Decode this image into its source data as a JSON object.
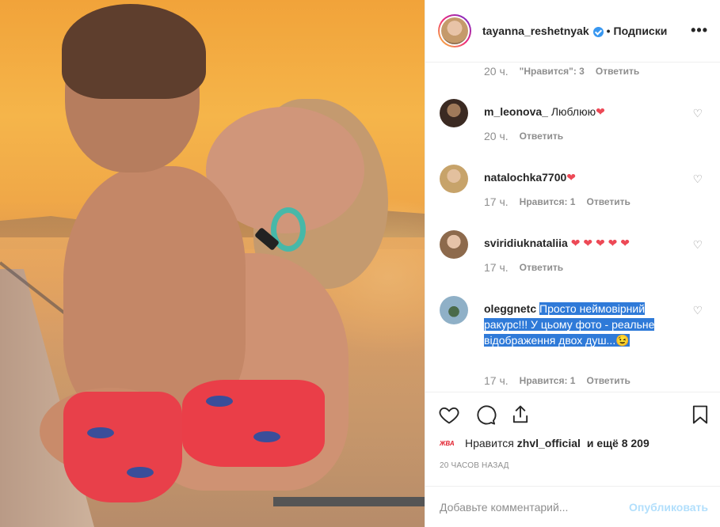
{
  "post": {
    "username": "tayanna_reshetnyak",
    "separator": "•",
    "follow_label": "Подписки",
    "more_icon": "more-icon"
  },
  "comments": {
    "top_meta": {
      "time": "20 ч.",
      "likes": "\"Нравится\": 3",
      "reply": "Ответить"
    },
    "items": [
      {
        "user": "m_leonova_",
        "text": "Люблюю",
        "emoji": "❤",
        "time": "20 ч.",
        "likes": "",
        "reply": "Ответить"
      },
      {
        "user": "natalochka7700",
        "text": "",
        "emoji": "❤",
        "time": "17 ч.",
        "likes": "Нравится: 1",
        "reply": "Ответить"
      },
      {
        "user": "sviridiuknataliia",
        "text": "",
        "emoji": "❤ ❤ ❤ ❤ ❤",
        "time": "17 ч.",
        "likes": "",
        "reply": "Ответить"
      },
      {
        "user": "oleggnetc",
        "text": "Просто неймовірний ракурс!!! У цьому фото - реальне відображення двох душ...",
        "emoji": "😉",
        "time": "17 ч.",
        "likes": "Нравится: 1",
        "reply": "Ответить"
      }
    ]
  },
  "likes": {
    "prefix": "Нравится",
    "user": "zhvl_official",
    "suffix": "и ещё 8 209",
    "badge": "ЖВА"
  },
  "date": "20 ЧАСОВ НАЗАД",
  "add_comment": {
    "placeholder": "Добавьте комментарий...",
    "publish": "Опубликовать"
  },
  "colors": {
    "verified": "#3897f0",
    "highlight": "#2f7ad8",
    "heart": "#ed4956",
    "publish": "#b2dffc"
  }
}
